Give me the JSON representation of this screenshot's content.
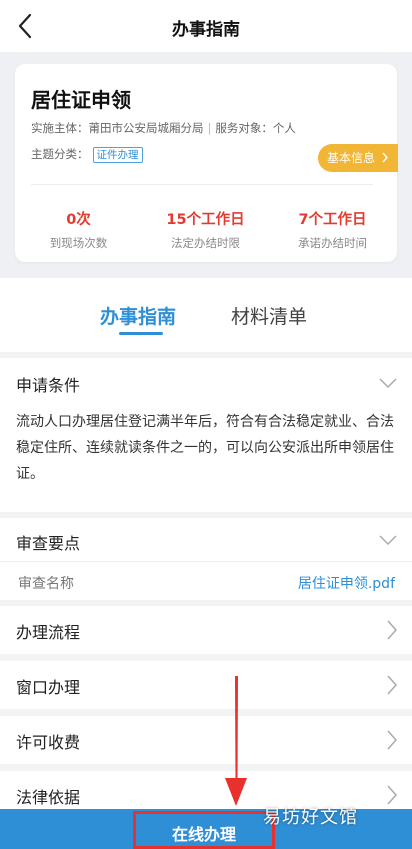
{
  "nav": {
    "title": "办事指南",
    "back_icon": "back-arrow-icon"
  },
  "service": {
    "name": "居住证申领",
    "impl_label": "实施主体：",
    "impl_value": "莆田市公安局城厢分局",
    "target_label": "服务对象：",
    "target_value": "个人",
    "category_label": "主题分类：",
    "category_tag": "证件办理",
    "info_button": "基本信息",
    "stats": [
      {
        "value": "0次",
        "label": "到现场次数"
      },
      {
        "value": "15个工作日",
        "label": "法定办结时限"
      },
      {
        "value": "7个工作日",
        "label": "承诺办结时间"
      }
    ]
  },
  "tabs": [
    {
      "label": "办事指南",
      "active": true
    },
    {
      "label": "材料清单",
      "active": false
    }
  ],
  "conditions": {
    "title": "申请条件",
    "text": "流动人口办理居住登记满半年后，符合有合法稳定就业、合法稳定住所、连续就读条件之一的，可以向公安派出所申领居住证。"
  },
  "review": {
    "title": "审查要点",
    "name_label": "审查名称",
    "file": "居住证申领.pdf"
  },
  "rows": [
    {
      "label": "办理流程"
    },
    {
      "label": "窗口办理"
    },
    {
      "label": "许可收费"
    },
    {
      "label": "法律依据"
    }
  ],
  "apply_button": "在线办理",
  "watermark": "易坊好文馆",
  "colors": {
    "accent": "#2f8fd6",
    "highlight": "#e8302d",
    "info": "#f2b637"
  }
}
